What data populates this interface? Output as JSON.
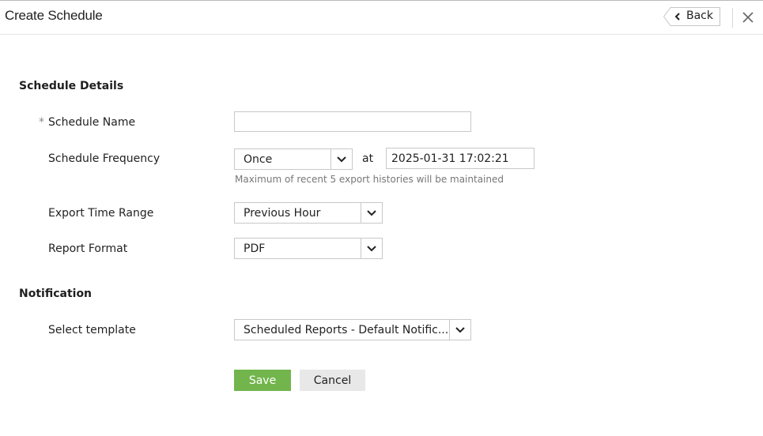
{
  "header": {
    "title": "Create Schedule",
    "back_label": "Back"
  },
  "schedule_details": {
    "section_title": "Schedule Details",
    "required_marker": "*",
    "name_label": "Schedule Name",
    "name_value": "",
    "frequency_label": "Schedule Frequency",
    "frequency_value": "Once",
    "at_label": "at",
    "datetime_value": "2025-01-31 17:02:21",
    "history_hint": "Maximum of recent 5 export histories will be maintained",
    "time_range_label": "Export Time Range",
    "time_range_value": "Previous Hour",
    "format_label": "Report Format",
    "format_value": "PDF"
  },
  "notification": {
    "section_title": "Notification",
    "template_label": "Select template",
    "template_value": "Scheduled Reports - Default Notific..."
  },
  "actions": {
    "save_label": "Save",
    "cancel_label": "Cancel"
  },
  "colors": {
    "save_button": "#72b54d",
    "cancel_button": "#e8e8e8"
  },
  "icons": {
    "back": "chevron-left-icon",
    "close": "close-icon",
    "dropdown": "chevron-down-icon"
  }
}
